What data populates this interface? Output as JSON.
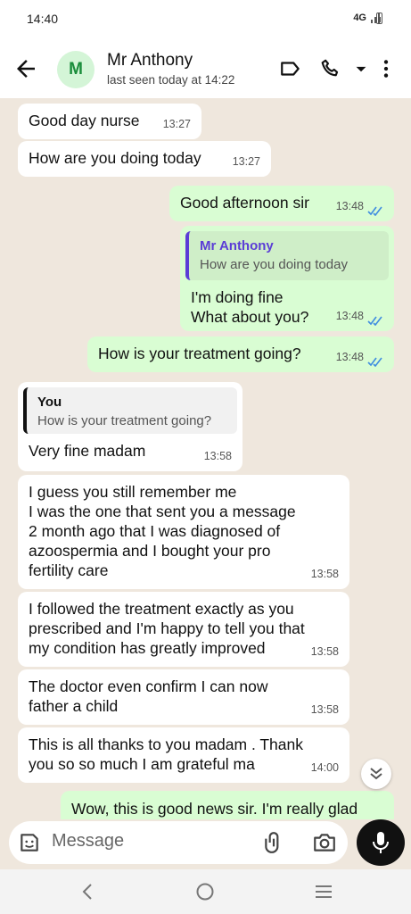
{
  "status_bar": {
    "time": "14:40",
    "network": "4G"
  },
  "header": {
    "avatar_letter": "M",
    "contact_name": "Mr Anthony",
    "last_seen": "last seen today at 14:22",
    "accent": "#1a8d3b"
  },
  "messages": [
    {
      "dir": "in",
      "text": "Good day nurse",
      "time": "13:27"
    },
    {
      "dir": "in",
      "text": "How are you doing today",
      "time": "13:27"
    },
    {
      "dir": "out",
      "text": "Good afternoon sir",
      "time": "13:48",
      "read": true
    },
    {
      "dir": "out",
      "quote_name": "Mr Anthony",
      "quote_text": "How are you doing today",
      "lines": [
        "I'm doing fine",
        "What about you?"
      ],
      "time": "13:48",
      "read": true
    },
    {
      "dir": "out",
      "text": "How is your treatment going?",
      "time": "13:48",
      "read": true
    },
    {
      "dir": "in",
      "quote_name": "You",
      "quote_text": "How is your treatment going?",
      "text": "Very fine madam",
      "time": "13:58"
    },
    {
      "dir": "in",
      "lines": [
        "I guess you still remember me",
        "I was the one that sent you a message",
        "2 month ago that I was diagnosed of",
        "azoospermia and I  bought your pro",
        "fertility care"
      ],
      "time": "13:58"
    },
    {
      "dir": "in",
      "lines": [
        "I followed the treatment exactly as you",
        "prescribed and I'm happy to tell you that",
        "my condition has greatly improved"
      ],
      "time": "13:58"
    },
    {
      "dir": "in",
      "lines": [
        "The  doctor even confirm I can now",
        "father a child"
      ],
      "time": "13:58"
    },
    {
      "dir": "in",
      "lines": [
        "This is all thanks to you madam .  Thank",
        "you so so much I am grateful ma"
      ],
      "time": "14:00"
    },
    {
      "dir": "out",
      "text": "Wow, this is good news sir. I'm really glad"
    }
  ],
  "input": {
    "placeholder": "Message"
  },
  "colors": {
    "chat_bg": "#efe7dd",
    "outgoing": "#d9fdd3",
    "incoming": "#ffffff",
    "read_ticks": "#3f8ce0"
  }
}
